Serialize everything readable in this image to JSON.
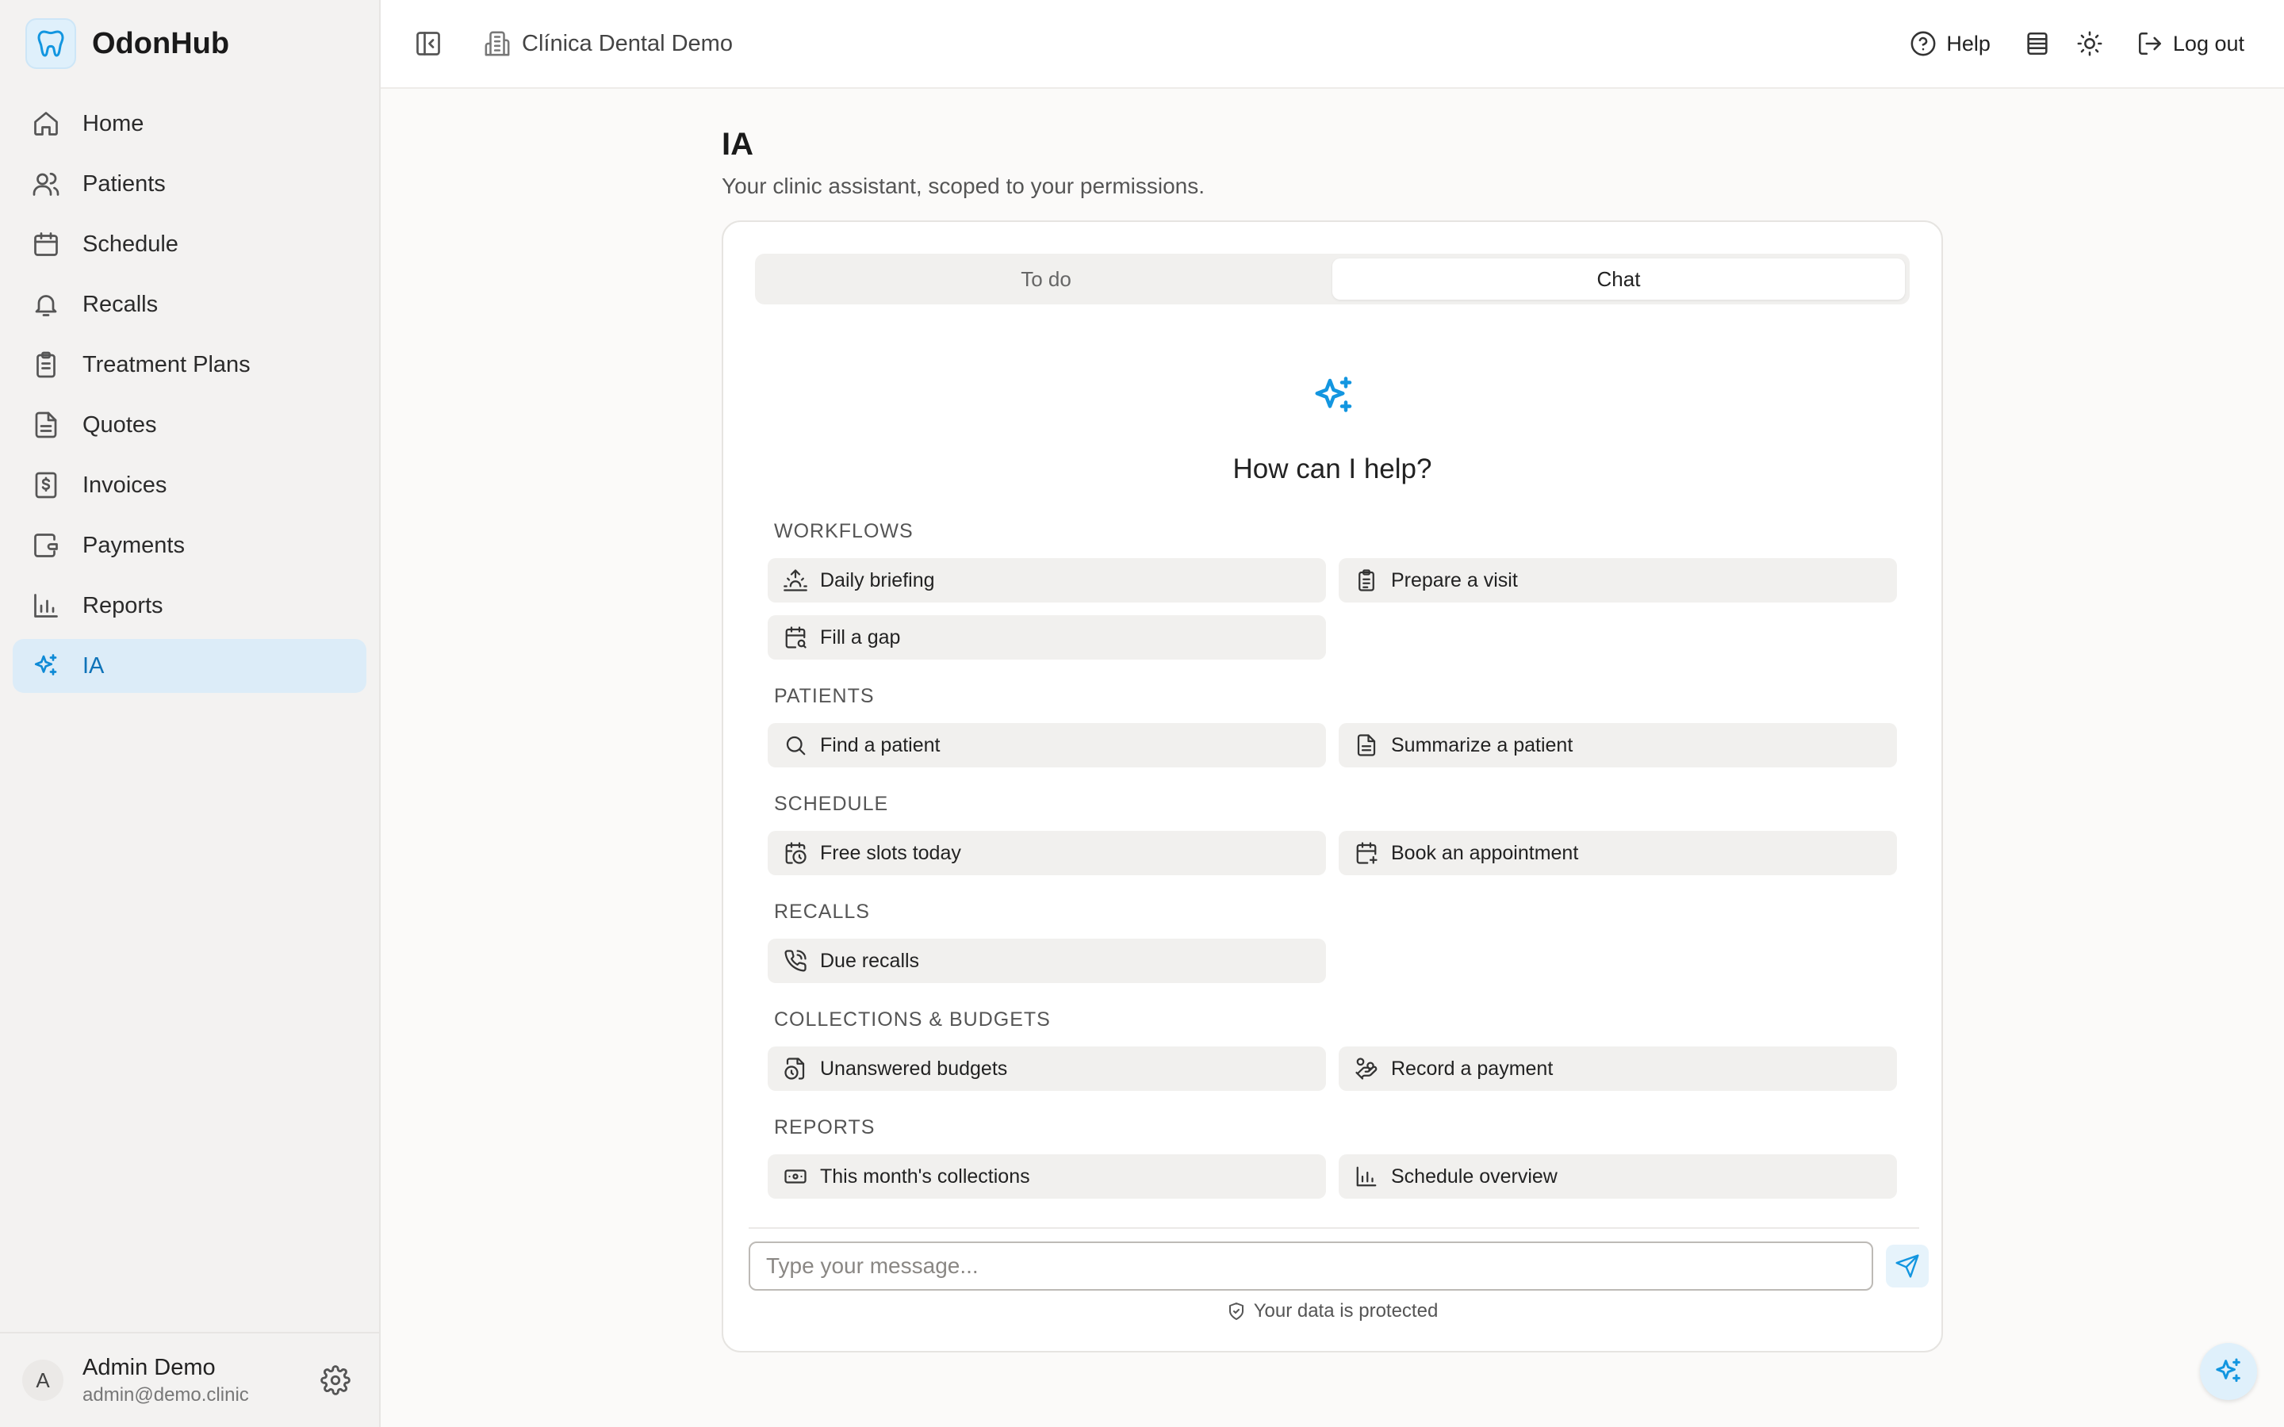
{
  "brand": {
    "name": "OdonHub",
    "logo_icon": "tooth-icon"
  },
  "sidebar": {
    "items": [
      {
        "label": "Home",
        "icon": "home-icon"
      },
      {
        "label": "Patients",
        "icon": "users-icon"
      },
      {
        "label": "Schedule",
        "icon": "calendar-icon"
      },
      {
        "label": "Recalls",
        "icon": "bell-icon"
      },
      {
        "label": "Treatment Plans",
        "icon": "clipboard-icon"
      },
      {
        "label": "Quotes",
        "icon": "file-text-icon"
      },
      {
        "label": "Invoices",
        "icon": "receipt-dollar-icon"
      },
      {
        "label": "Payments",
        "icon": "wallet-icon"
      },
      {
        "label": "Reports",
        "icon": "bar-chart-icon"
      },
      {
        "label": "IA",
        "icon": "sparkles-icon",
        "active": true
      }
    ]
  },
  "user": {
    "initial": "A",
    "name": "Admin Demo",
    "email": "admin@demo.clinic"
  },
  "topbar": {
    "clinic": "Clínica Dental Demo",
    "help_label": "Help",
    "logout_label": "Log out"
  },
  "page": {
    "title": "IA",
    "subtitle": "Your clinic assistant, scoped to your permissions."
  },
  "tabs": [
    {
      "label": "To do"
    },
    {
      "label": "Chat",
      "active": true
    }
  ],
  "chat": {
    "heading": "How can I help?",
    "sections": [
      {
        "label": "WORKFLOWS",
        "prompts": [
          "Daily briefing",
          "Prepare a visit",
          "Fill a gap"
        ]
      },
      {
        "label": "PATIENTS",
        "prompts": [
          "Find a patient",
          "Summarize a patient"
        ]
      },
      {
        "label": "SCHEDULE",
        "prompts": [
          "Free slots today",
          "Book an appointment"
        ]
      },
      {
        "label": "RECALLS",
        "prompts": [
          "Due recalls"
        ]
      },
      {
        "label": "COLLECTIONS & BUDGETS",
        "prompts": [
          "Unanswered budgets",
          "Record a payment"
        ]
      },
      {
        "label": "REPORTS",
        "prompts": [
          "This month's collections",
          "Schedule overview"
        ]
      }
    ],
    "input_placeholder": "Type your message...",
    "privacy_note": "Your data is protected"
  },
  "colors": {
    "accent": "#1396e0",
    "active_bg": "#dcecf8",
    "sidebar_bg": "#f3f2f1"
  }
}
